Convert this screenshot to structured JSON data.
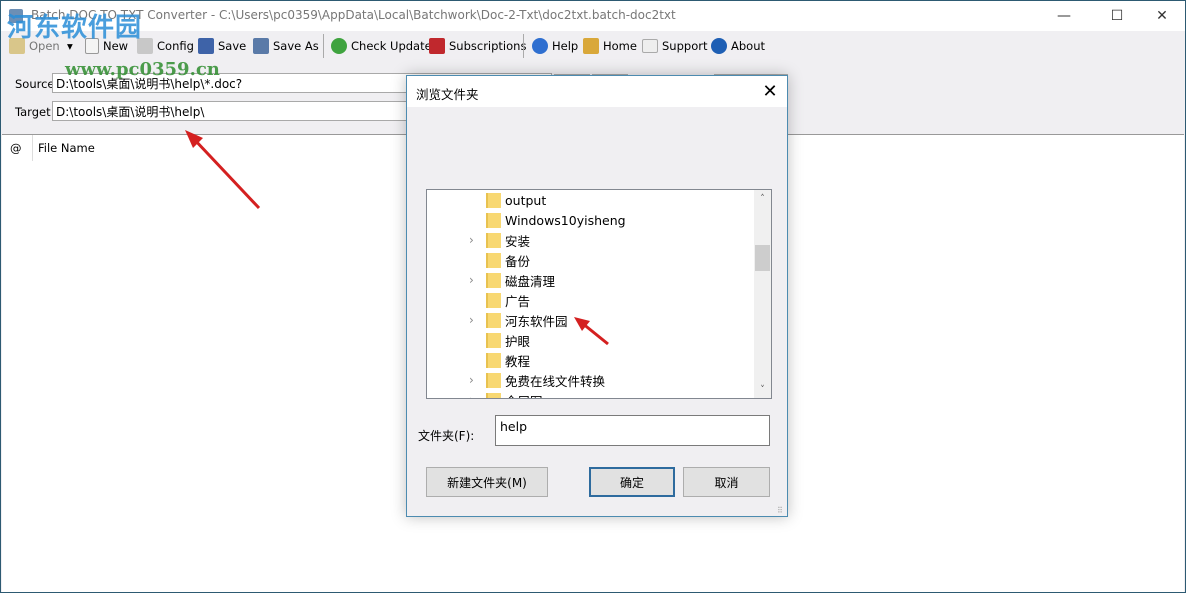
{
  "window": {
    "title": "Batch DOC TO TXT Converter - C:\\Users\\pc0359\\AppData\\Local\\Batchwork\\Doc-2-Txt\\doc2txt.batch-doc2txt",
    "controls": {
      "minimize": "—",
      "maximize": "☐",
      "close": "✕"
    }
  },
  "toolbar": {
    "items": [
      {
        "label": "Open",
        "icon": "open-folder-icon"
      },
      {
        "label": "New",
        "icon": "new-file-icon"
      },
      {
        "label": "Config",
        "icon": "config-tools-icon"
      },
      {
        "label": "Save",
        "icon": "save-disk-icon"
      },
      {
        "label": "Save As",
        "icon": "save-as-icon"
      },
      {
        "label": "Check Update",
        "icon": "refresh-icon"
      },
      {
        "label": "Subscriptions",
        "icon": "cart-icon"
      },
      {
        "label": "Help",
        "icon": "help-icon"
      },
      {
        "label": "Home",
        "icon": "home-icon"
      },
      {
        "label": "Support",
        "icon": "support-icon"
      },
      {
        "label": "About",
        "icon": "info-icon"
      }
    ],
    "open_dropdown": "▾"
  },
  "paths": {
    "source_label": "Source",
    "source_value": "D:\\tools\\桌面\\说明书\\help\\*.doc?",
    "target_label": "Target",
    "target_value": "D:\\tools\\桌面\\说明书\\help\\"
  },
  "file_list": {
    "columns": [
      "@",
      "File Name"
    ]
  },
  "watermark": {
    "text": "河东软件园",
    "url_text": "www.pc0359.cn"
  },
  "dialog": {
    "title": "浏览文件夹",
    "close": "✕",
    "tree_items": [
      {
        "label": "output",
        "expandable": false
      },
      {
        "label": "Windows10yisheng",
        "expandable": false
      },
      {
        "label": "安装",
        "expandable": true
      },
      {
        "label": "备份",
        "expandable": false
      },
      {
        "label": "磁盘清理",
        "expandable": true
      },
      {
        "label": "广告",
        "expandable": false
      },
      {
        "label": "河东软件园",
        "expandable": true
      },
      {
        "label": "护眼",
        "expandable": false
      },
      {
        "label": "教程",
        "expandable": false
      },
      {
        "label": "免费在线文件转换",
        "expandable": true
      },
      {
        "label": "全屏图",
        "expandable": true
      }
    ],
    "scroll_up": "˄",
    "scroll_down": "˅",
    "folder_label": "文件夹(F):",
    "folder_value": "help",
    "new_folder_button": "新建文件夹(M)",
    "ok_button": "确定",
    "cancel_button": "取消",
    "expander_glyph": "›"
  }
}
